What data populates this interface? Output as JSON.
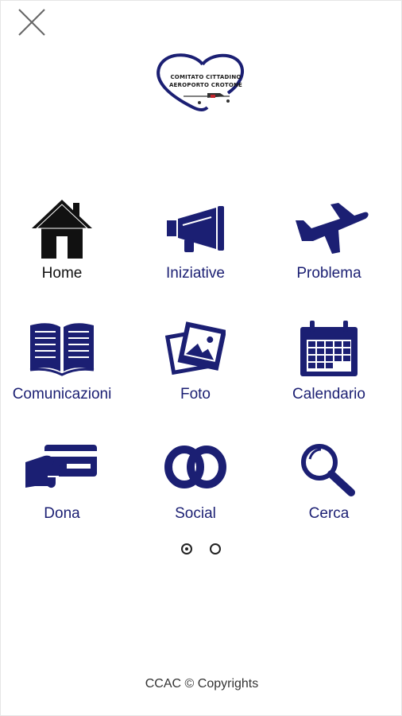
{
  "logo": {
    "line1": "COMITATO CITTADINO",
    "line2": "AEROPORTO CROTONE"
  },
  "menu": [
    {
      "label": "Home",
      "icon": "home-icon"
    },
    {
      "label": "Iniziative",
      "icon": "megaphone-icon"
    },
    {
      "label": "Problema",
      "icon": "airplane-icon"
    },
    {
      "label": "Comunicazioni",
      "icon": "book-icon"
    },
    {
      "label": "Foto",
      "icon": "photos-icon"
    },
    {
      "label": "Calendario",
      "icon": "calendar-icon"
    },
    {
      "label": "Dona",
      "icon": "credit-card-icon"
    },
    {
      "label": "Social",
      "icon": "linked-rings-icon"
    },
    {
      "label": "Cerca",
      "icon": "magnifier-icon"
    }
  ],
  "pagination": {
    "pages": 2,
    "active": 1
  },
  "footer": "CCAC © Copyrights",
  "colors": {
    "accent": "#1b1f73",
    "home_icon": "#111111"
  }
}
